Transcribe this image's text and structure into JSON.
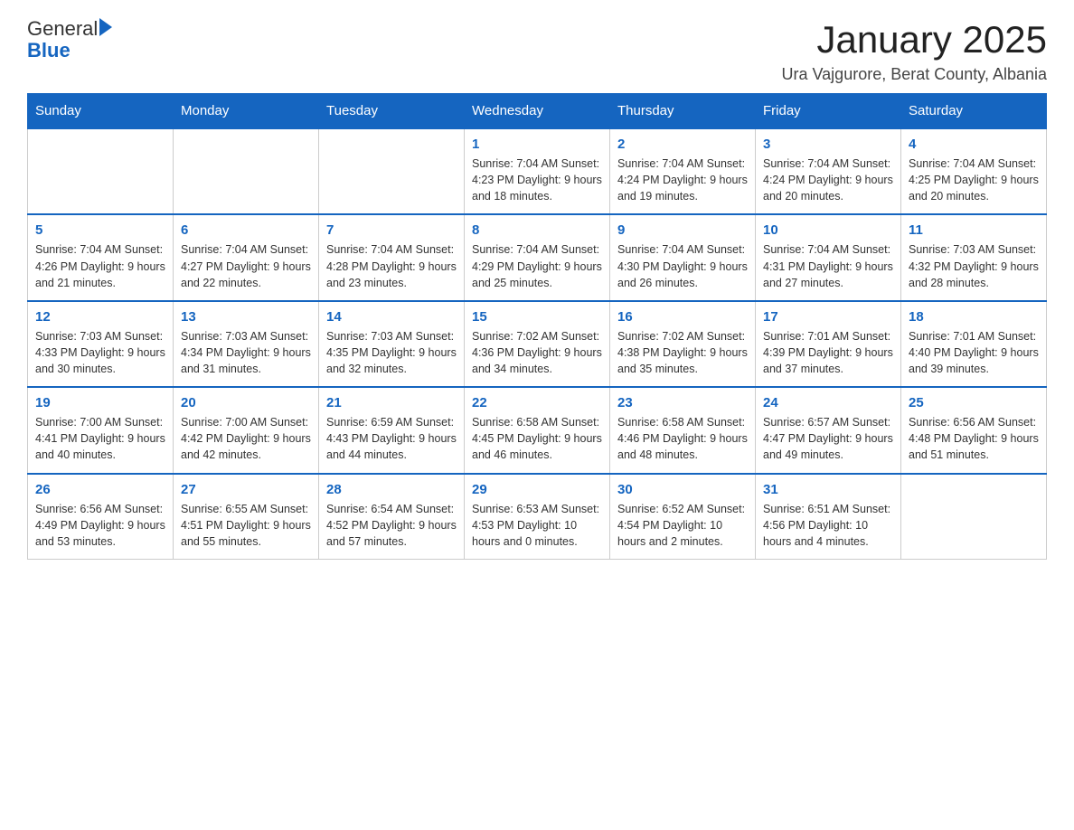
{
  "header": {
    "logo": {
      "text_general": "General",
      "text_blue": "Blue",
      "arrow_unicode": "▶"
    },
    "title": "January 2025",
    "subtitle": "Ura Vajgurore, Berat County, Albania"
  },
  "calendar": {
    "days_of_week": [
      "Sunday",
      "Monday",
      "Tuesday",
      "Wednesday",
      "Thursday",
      "Friday",
      "Saturday"
    ],
    "weeks": [
      {
        "cells": [
          {
            "day": null,
            "info": null
          },
          {
            "day": null,
            "info": null
          },
          {
            "day": null,
            "info": null
          },
          {
            "day": "1",
            "info": "Sunrise: 7:04 AM\nSunset: 4:23 PM\nDaylight: 9 hours\nand 18 minutes."
          },
          {
            "day": "2",
            "info": "Sunrise: 7:04 AM\nSunset: 4:24 PM\nDaylight: 9 hours\nand 19 minutes."
          },
          {
            "day": "3",
            "info": "Sunrise: 7:04 AM\nSunset: 4:24 PM\nDaylight: 9 hours\nand 20 minutes."
          },
          {
            "day": "4",
            "info": "Sunrise: 7:04 AM\nSunset: 4:25 PM\nDaylight: 9 hours\nand 20 minutes."
          }
        ]
      },
      {
        "cells": [
          {
            "day": "5",
            "info": "Sunrise: 7:04 AM\nSunset: 4:26 PM\nDaylight: 9 hours\nand 21 minutes."
          },
          {
            "day": "6",
            "info": "Sunrise: 7:04 AM\nSunset: 4:27 PM\nDaylight: 9 hours\nand 22 minutes."
          },
          {
            "day": "7",
            "info": "Sunrise: 7:04 AM\nSunset: 4:28 PM\nDaylight: 9 hours\nand 23 minutes."
          },
          {
            "day": "8",
            "info": "Sunrise: 7:04 AM\nSunset: 4:29 PM\nDaylight: 9 hours\nand 25 minutes."
          },
          {
            "day": "9",
            "info": "Sunrise: 7:04 AM\nSunset: 4:30 PM\nDaylight: 9 hours\nand 26 minutes."
          },
          {
            "day": "10",
            "info": "Sunrise: 7:04 AM\nSunset: 4:31 PM\nDaylight: 9 hours\nand 27 minutes."
          },
          {
            "day": "11",
            "info": "Sunrise: 7:03 AM\nSunset: 4:32 PM\nDaylight: 9 hours\nand 28 minutes."
          }
        ]
      },
      {
        "cells": [
          {
            "day": "12",
            "info": "Sunrise: 7:03 AM\nSunset: 4:33 PM\nDaylight: 9 hours\nand 30 minutes."
          },
          {
            "day": "13",
            "info": "Sunrise: 7:03 AM\nSunset: 4:34 PM\nDaylight: 9 hours\nand 31 minutes."
          },
          {
            "day": "14",
            "info": "Sunrise: 7:03 AM\nSunset: 4:35 PM\nDaylight: 9 hours\nand 32 minutes."
          },
          {
            "day": "15",
            "info": "Sunrise: 7:02 AM\nSunset: 4:36 PM\nDaylight: 9 hours\nand 34 minutes."
          },
          {
            "day": "16",
            "info": "Sunrise: 7:02 AM\nSunset: 4:38 PM\nDaylight: 9 hours\nand 35 minutes."
          },
          {
            "day": "17",
            "info": "Sunrise: 7:01 AM\nSunset: 4:39 PM\nDaylight: 9 hours\nand 37 minutes."
          },
          {
            "day": "18",
            "info": "Sunrise: 7:01 AM\nSunset: 4:40 PM\nDaylight: 9 hours\nand 39 minutes."
          }
        ]
      },
      {
        "cells": [
          {
            "day": "19",
            "info": "Sunrise: 7:00 AM\nSunset: 4:41 PM\nDaylight: 9 hours\nand 40 minutes."
          },
          {
            "day": "20",
            "info": "Sunrise: 7:00 AM\nSunset: 4:42 PM\nDaylight: 9 hours\nand 42 minutes."
          },
          {
            "day": "21",
            "info": "Sunrise: 6:59 AM\nSunset: 4:43 PM\nDaylight: 9 hours\nand 44 minutes."
          },
          {
            "day": "22",
            "info": "Sunrise: 6:58 AM\nSunset: 4:45 PM\nDaylight: 9 hours\nand 46 minutes."
          },
          {
            "day": "23",
            "info": "Sunrise: 6:58 AM\nSunset: 4:46 PM\nDaylight: 9 hours\nand 48 minutes."
          },
          {
            "day": "24",
            "info": "Sunrise: 6:57 AM\nSunset: 4:47 PM\nDaylight: 9 hours\nand 49 minutes."
          },
          {
            "day": "25",
            "info": "Sunrise: 6:56 AM\nSunset: 4:48 PM\nDaylight: 9 hours\nand 51 minutes."
          }
        ]
      },
      {
        "cells": [
          {
            "day": "26",
            "info": "Sunrise: 6:56 AM\nSunset: 4:49 PM\nDaylight: 9 hours\nand 53 minutes."
          },
          {
            "day": "27",
            "info": "Sunrise: 6:55 AM\nSunset: 4:51 PM\nDaylight: 9 hours\nand 55 minutes."
          },
          {
            "day": "28",
            "info": "Sunrise: 6:54 AM\nSunset: 4:52 PM\nDaylight: 9 hours\nand 57 minutes."
          },
          {
            "day": "29",
            "info": "Sunrise: 6:53 AM\nSunset: 4:53 PM\nDaylight: 10 hours\nand 0 minutes."
          },
          {
            "day": "30",
            "info": "Sunrise: 6:52 AM\nSunset: 4:54 PM\nDaylight: 10 hours\nand 2 minutes."
          },
          {
            "day": "31",
            "info": "Sunrise: 6:51 AM\nSunset: 4:56 PM\nDaylight: 10 hours\nand 4 minutes."
          },
          {
            "day": null,
            "info": null
          }
        ]
      }
    ]
  }
}
